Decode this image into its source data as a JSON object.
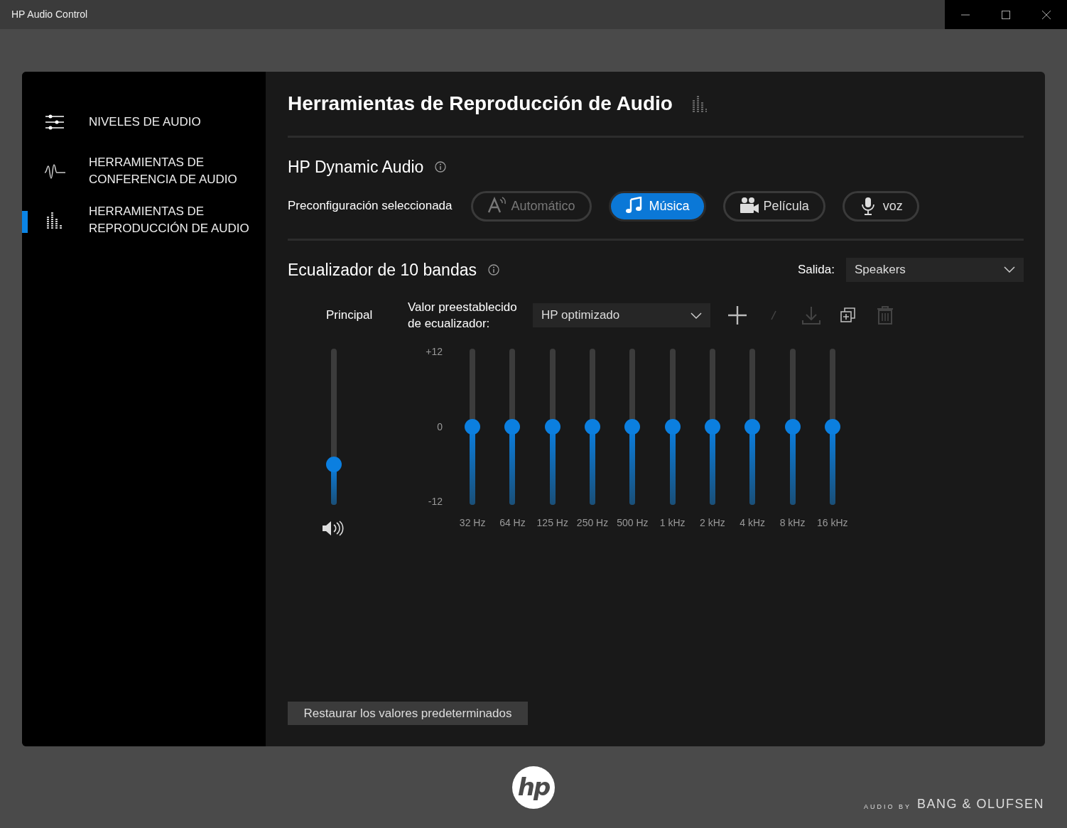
{
  "window": {
    "title": "HP Audio Control"
  },
  "sidebar": {
    "items": [
      {
        "kind": "levels",
        "label": "NIVELES DE AUDIO",
        "selected": false
      },
      {
        "kind": "conference",
        "label": "HERRAMIENTAS DE CONFERENCIA DE AUDIO",
        "selected": false
      },
      {
        "kind": "playback",
        "label": "HERRAMIENTAS DE REPRODUCCIÓN DE AUDIO",
        "selected": true
      }
    ]
  },
  "page_title": "Herramientas de Reproducción de Audio",
  "dynamic_audio": {
    "title": "HP Dynamic Audio",
    "preset_label": "Preconfiguración seleccionada",
    "presets": [
      {
        "kind": "auto",
        "label": "Automático",
        "selected": false,
        "disabled": true
      },
      {
        "kind": "music",
        "label": "Música",
        "selected": true,
        "disabled": false
      },
      {
        "kind": "movie",
        "label": "Película",
        "selected": false,
        "disabled": false
      },
      {
        "kind": "voice",
        "label": "voz",
        "selected": false,
        "disabled": false
      }
    ]
  },
  "equalizer": {
    "title": "Ecualizador de 10 bandas",
    "output_label": "Salida:",
    "output_value": "Speakers",
    "master_label": "Principal",
    "master_slider": {
      "level": 0.26
    },
    "preset_label": "Valor preestablecido de ecualizador:",
    "preset_value": "HP optimizado",
    "tools": [
      {
        "kind": "add",
        "disabled": false
      },
      {
        "kind": "edit",
        "disabled": true
      },
      {
        "kind": "download",
        "disabled": true
      },
      {
        "kind": "duplicate",
        "disabled": false
      },
      {
        "kind": "delete",
        "disabled": true
      }
    ],
    "scale": [
      "+12",
      "0",
      "-12"
    ],
    "bands": [
      {
        "label": "32 Hz",
        "level": 0.5
      },
      {
        "label": "64 Hz",
        "level": 0.5
      },
      {
        "label": "125 Hz",
        "level": 0.5
      },
      {
        "label": "250 Hz",
        "level": 0.5
      },
      {
        "label": "500 Hz",
        "level": 0.5
      },
      {
        "label": "1 kHz",
        "level": 0.5
      },
      {
        "label": "2 kHz",
        "level": 0.5
      },
      {
        "label": "4 kHz",
        "level": 0.5
      },
      {
        "label": "8 kHz",
        "level": 0.5
      },
      {
        "label": "16 kHz",
        "level": 0.5
      }
    ]
  },
  "restore_button": "Restaurar los valores predeterminados",
  "footer": {
    "logo": "hp",
    "credit_prefix": "AUDIO BY",
    "credit_brand": "BANG & OLUFSEN"
  }
}
